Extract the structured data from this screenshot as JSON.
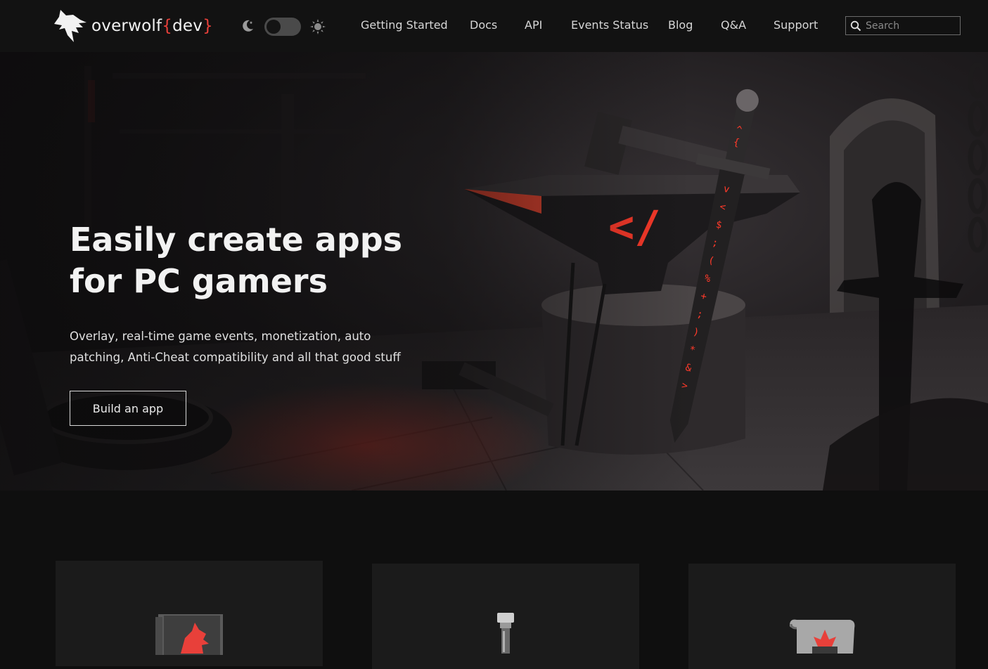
{
  "brand": {
    "name": "overwolf",
    "bracket_open": "{",
    "suffix": "dev",
    "bracket_close": "}",
    "accent_color": "#e8403a"
  },
  "theme_toggle": {
    "dark_icon": "moon-icon",
    "light_icon": "sun-icon",
    "state": "dark"
  },
  "nav": {
    "items": [
      "Getting Started",
      "Docs",
      "API",
      "Events Status",
      "Blog",
      "Q&A",
      "Support"
    ]
  },
  "search": {
    "placeholder": "Search",
    "value": "",
    "icon": "search-icon"
  },
  "hero": {
    "title_line1": "Easily create apps",
    "title_line2": "for PC gamers",
    "subtitle_line1": "Overlay, real-time game events, monetization, auto",
    "subtitle_line2": "patching, Anti-Cheat compatibility and all that good stuff",
    "cta_label": "Build an app",
    "image": {
      "description_icons": [
        "anvil",
        "hammer",
        "sword"
      ],
      "code_glyph": "</",
      "rune_text": "^{*-<$;-(%+;)*&>"
    }
  },
  "cards": [
    {
      "icon": "wolf-book-icon"
    },
    {
      "icon": "bottle-icon"
    },
    {
      "icon": "scroll-icon"
    }
  ],
  "colors": {
    "nav_bg": "#121212",
    "page_bg": "#0f0f0f",
    "card_bg": "#1b1b1b",
    "glow_red": "#ff3a2a"
  }
}
